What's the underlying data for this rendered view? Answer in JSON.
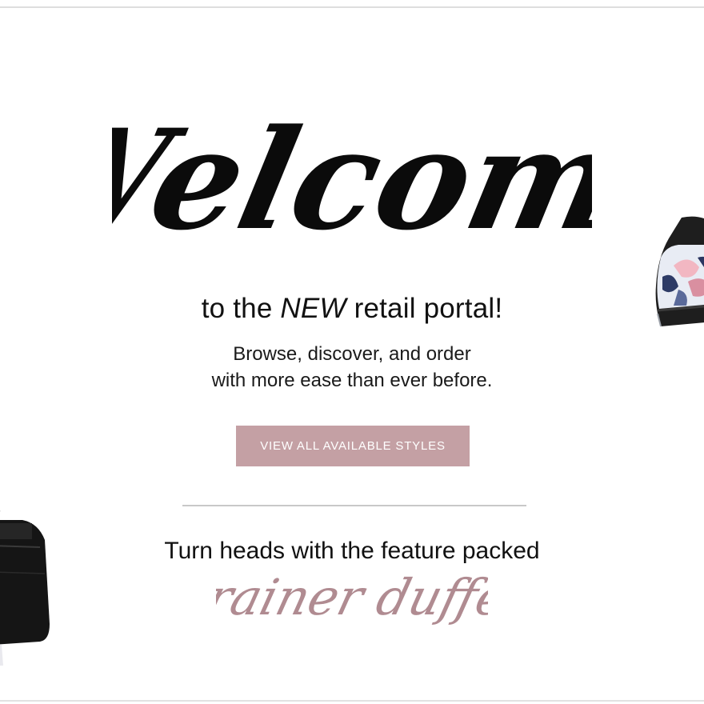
{
  "hero": {
    "welcome_script": "Welcome",
    "tagline_prefix": "to the ",
    "tagline_emphasis": "NEW",
    "tagline_suffix": " retail portal!",
    "subtext_line1": "Browse, discover, and order",
    "subtext_line2": "with more ease than ever before."
  },
  "cta": {
    "label": "VIEW ALL AVAILABLE STYLES",
    "color": "#c4a0a4"
  },
  "feature": {
    "headline": "Turn heads with the feature packed",
    "product_script": "trainer duffel",
    "script_color": "#b08b91"
  },
  "products": {
    "left_image": "black-duffel-bag",
    "right_image": "floral-black-bag"
  }
}
